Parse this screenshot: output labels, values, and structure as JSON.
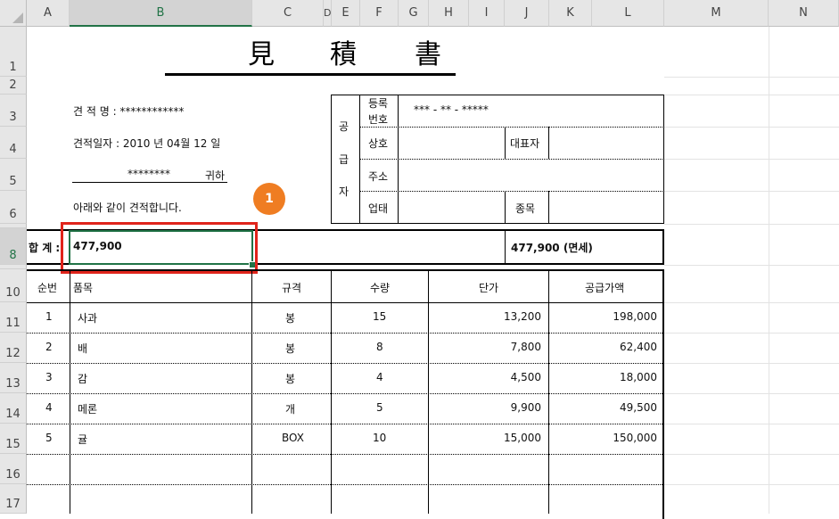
{
  "columns": [
    "A",
    "B",
    "C",
    "D",
    "E",
    "F",
    "G",
    "H",
    "I",
    "J",
    "K",
    "L",
    "M",
    "N"
  ],
  "rows": [
    "1",
    "2",
    "3",
    "4",
    "5",
    "6",
    "8",
    "10",
    "11",
    "12",
    "13",
    "14",
    "15",
    "16",
    "17"
  ],
  "doc": {
    "title_chars": [
      "見",
      "積",
      "書"
    ],
    "estimate_name_label": "견 적 명 : ************",
    "estimate_date_label": "견적일자 : 2010   년   04월    12 일",
    "addressee": "********",
    "addressee_suffix": "귀하",
    "intro": "아래와 같이 견적합니다.",
    "callout": "1",
    "supplier": {
      "side_chars": [
        "공",
        "급",
        "자"
      ],
      "reg_label_1": "등록",
      "reg_label_2": "번호",
      "reg_value": "*** - ** - *****",
      "company_label": "상호",
      "rep_label": "대표자",
      "address_label": "주소",
      "business_label": "업태",
      "item_label": "종목"
    },
    "total": {
      "label": "합 계 :",
      "value": "477,900",
      "right_value": "477,900 (면세)"
    },
    "table": {
      "headers": [
        "순번",
        "품목",
        "규격",
        "수량",
        "단가",
        "공급가액"
      ],
      "rows": [
        [
          "1",
          "사과",
          "봉",
          "15",
          "13,200",
          "198,000"
        ],
        [
          "2",
          "배",
          "봉",
          "8",
          "7,800",
          "62,400"
        ],
        [
          "3",
          "감",
          "봉",
          "4",
          "4,500",
          "18,000"
        ],
        [
          "4",
          "메론",
          "개",
          "5",
          "9,900",
          "49,500"
        ],
        [
          "5",
          "귤",
          "BOX",
          "10",
          "15,000",
          "150,000"
        ]
      ]
    }
  },
  "colors": {
    "selection": "#217346",
    "highlight": "#e0241b",
    "callout": "#ef7d22"
  }
}
